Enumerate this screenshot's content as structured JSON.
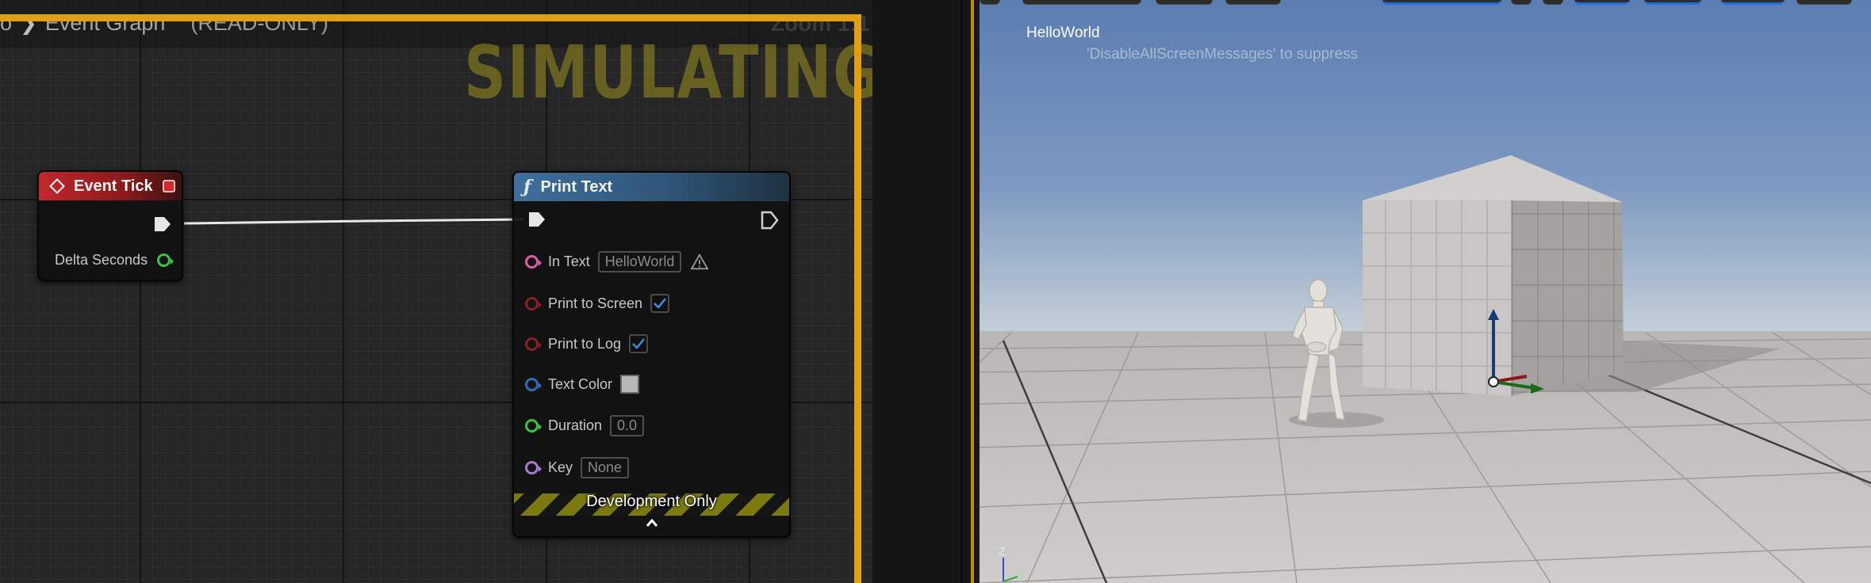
{
  "graph": {
    "breadcrumb": {
      "partial": "o",
      "title": "Event Graph",
      "mode": "(READ-ONLY)"
    },
    "zoom": "Zoom 1:1",
    "watermark": "SIMULATING"
  },
  "nodes": {
    "event_tick": {
      "title": "Event Tick",
      "pins": {
        "delta_seconds": "Delta Seconds"
      }
    },
    "print_text": {
      "title": "Print Text",
      "pins": {
        "in_text": {
          "label": "In Text",
          "value": "HelloWorld"
        },
        "print_to_screen": {
          "label": "Print to Screen",
          "checked": true
        },
        "print_to_log": {
          "label": "Print to Log",
          "checked": true
        },
        "text_color": {
          "label": "Text Color",
          "color": "#b8b8b8"
        },
        "duration": {
          "label": "Duration",
          "value": "0.0"
        },
        "key": {
          "label": "Key",
          "value": "None"
        }
      },
      "footer": "Development Only"
    }
  },
  "viewport": {
    "messages": {
      "hello": "HelloWorld",
      "suppress": "'DisableAllScreenMessages' to suppress"
    },
    "axis": {
      "z": "Z",
      "y": "y"
    }
  },
  "colors": {
    "simulating_border": "#e2a00e",
    "event_header": "#c3272a",
    "function_header": "#3f6f9c",
    "sky_top": "#5c7eb2",
    "sky_horizon": "#b9c6d3"
  }
}
